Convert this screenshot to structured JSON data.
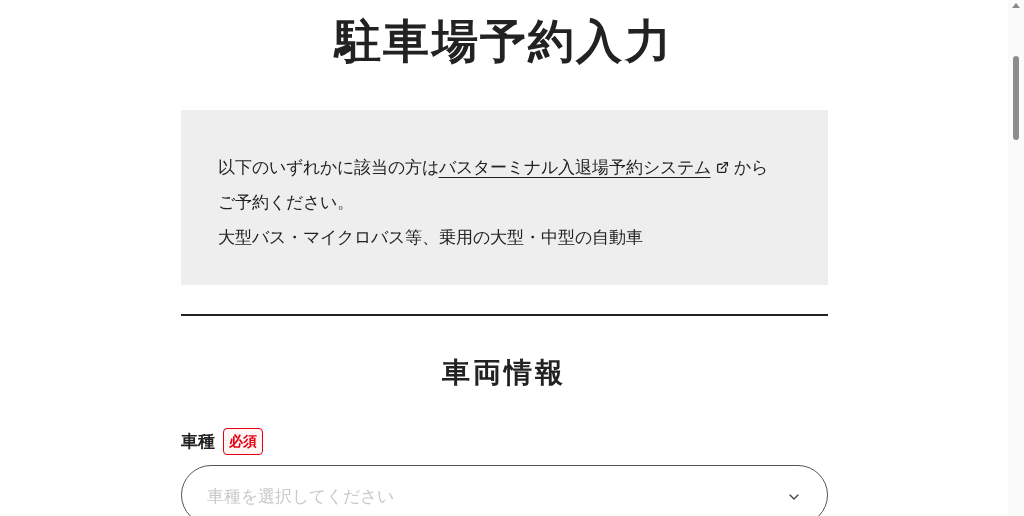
{
  "page_title": "駐車場予約入力",
  "notice": {
    "text_before": "以下のいずれかに該当の方は",
    "link": "バスターミナル入退場予約システム",
    "text_after": "からご予約ください。",
    "condition": "大型バス・マイクロバス等、乗用の大型・中型の自動車"
  },
  "section_title": "車両情報",
  "fields": [
    {
      "label": "車種",
      "required": true,
      "required_badge": "必須",
      "placeholder": "車種を選択してください"
    }
  ]
}
